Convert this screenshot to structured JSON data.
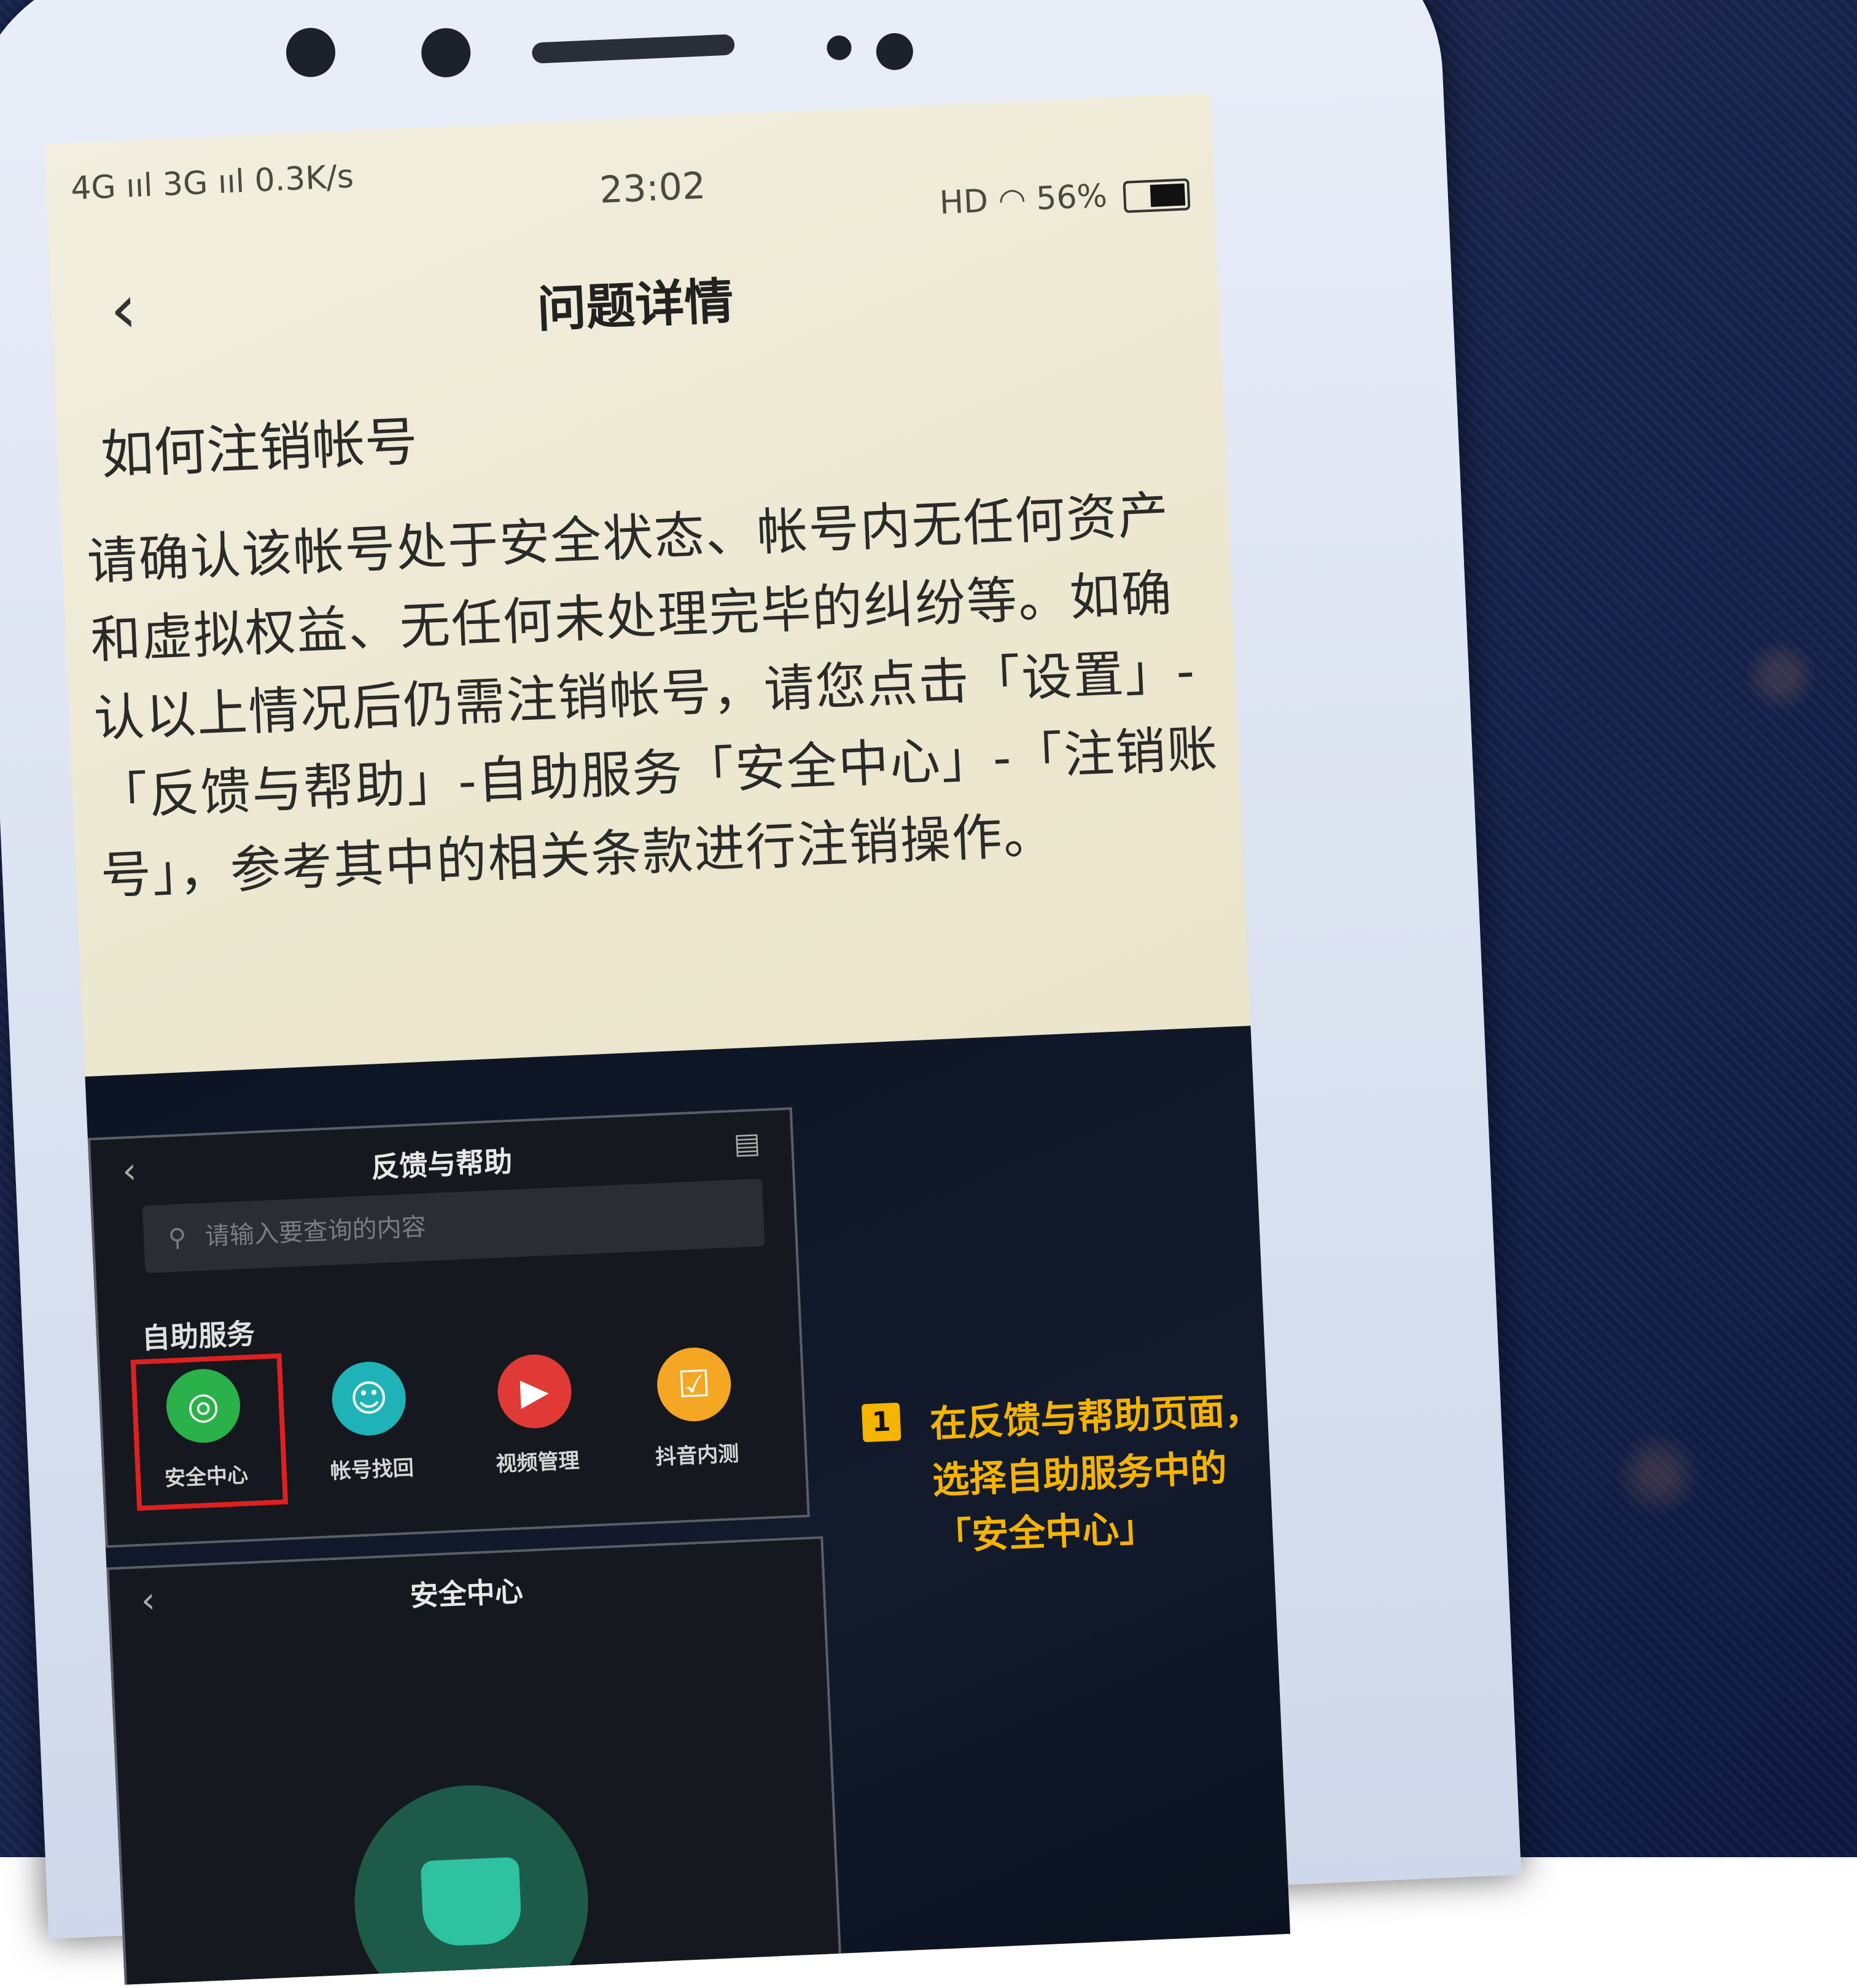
{
  "status_bar": {
    "network_left": "4G ııl 3G ııl 0.3K/s",
    "time": "23:02",
    "network_right": "HD",
    "battery": "56%"
  },
  "header": {
    "back_icon": "chevron-left-icon",
    "title": "问题详情"
  },
  "article": {
    "question": "如何注销帐号",
    "body": "请确认该帐号处于安全状态、帐号内无任何资产和虚拟权益、无任何未处理完毕的纠纷等。如确认以上情况后仍需注销帐号，请您点击「设置」-「反馈与帮助」-自助服务「安全中心」-「注销账号」，参考其中的相关条款进行注销操作。"
  },
  "illustration": {
    "panel1": {
      "title": "反馈与帮助",
      "search_placeholder": "请输入要查询的内容",
      "section_label": "自助服务",
      "services": [
        {
          "label": "安全中心",
          "icon": "shield-icon",
          "color": "#2bb14a"
        },
        {
          "label": "帐号找回",
          "icon": "person-icon",
          "color": "#1fb3b8"
        },
        {
          "label": "视频管理",
          "icon": "video-icon",
          "color": "#e03a36"
        },
        {
          "label": "抖音内测",
          "icon": "clipboard-icon",
          "color": "#f5a623"
        }
      ]
    },
    "step": {
      "number": "1",
      "text": "在反馈与帮助页面，选择自助服务中的「安全中心」"
    },
    "panel2": {
      "title": "安全中心"
    }
  },
  "colors": {
    "accent": "#f5b400",
    "highlight": "#e02020",
    "fabric": "#1a2550"
  }
}
